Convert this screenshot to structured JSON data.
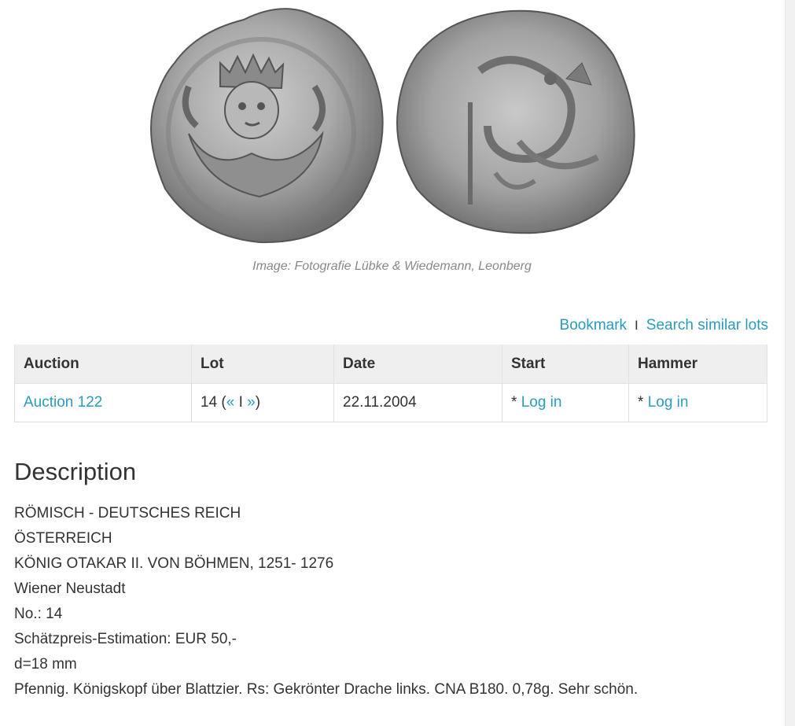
{
  "image": {
    "caption": "Image: Fotografie Lübke & Wiedemann, Leonberg",
    "obverse_icon": "coin-obverse-icon",
    "reverse_icon": "coin-reverse-icon"
  },
  "actions": {
    "bookmark": "Bookmark",
    "separator": "I",
    "search_similar": "Search similar lots"
  },
  "table": {
    "headers": [
      "Auction",
      "Lot",
      "Date",
      "Start",
      "Hammer"
    ],
    "row": {
      "auction": "Auction 122",
      "lot_number": "14 (",
      "lot_prev": "«",
      "lot_sep": " I ",
      "lot_next": "»",
      "lot_close": ")",
      "date": "22.11.2004",
      "start_prefix": "* ",
      "start_link": "Log in",
      "hammer_prefix": "* ",
      "hammer_link": "Log in"
    }
  },
  "description": {
    "title": "Description",
    "lines": [
      "RÖMISCH - DEUTSCHES REICH",
      "ÖSTERREICH",
      "KÖNIG OTAKAR II. VON BÖHMEN, 1251- 1276",
      "Wiener Neustadt",
      "No.: 14",
      "Schätzpreis-Estimation: EUR 50,-",
      "d=18 mm",
      "Pfennig. Königskopf über Blattzier. Rs: Gekrönter Drache links. CNA B180. 0,78g. Sehr schön."
    ]
  },
  "colors": {
    "link": "#2a9bbd",
    "text": "#333333",
    "caption": "#888888",
    "header_bg": "#efefef"
  }
}
